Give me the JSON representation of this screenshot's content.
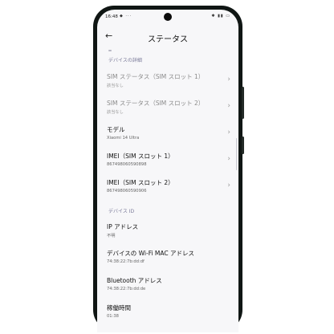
{
  "status_bar": {
    "time": "16:48",
    "left_icons": "◆ ···",
    "right_icons": "✱ ▮▮ ▭"
  },
  "header": {
    "back_icon": "←",
    "title": "ステータス"
  },
  "sections": {
    "device_details": "デバイスの詳細",
    "device_id": "デバイス ID"
  },
  "rows": [
    {
      "label": "SIM ステータス（SIM スロット 1）",
      "value": "該当なし",
      "chevron": "›"
    },
    {
      "label": "SIM ステータス（SIM スロット 2）",
      "value": "該当なし",
      "chevron": "›"
    },
    {
      "label": "モデル",
      "value": "Xiaomi 14 Ultra",
      "chevron": "›"
    },
    {
      "label": "IMEI（SIM スロット 1）",
      "value": "867498060590898",
      "chevron": "›"
    },
    {
      "label": "IMEI（SIM スロット 2）",
      "value": "867498060590906",
      "chevron": "›"
    },
    {
      "label": "IP アドレス",
      "value": "不明"
    },
    {
      "label": "デバイスの Wi-Fi MAC アドレス",
      "value": "74:38:22:7b:dd:df"
    },
    {
      "label": "Bluetooth アドレス",
      "value": "74:38:22:7b:dd:de"
    },
    {
      "label": "稼働時間",
      "value": "01:38"
    }
  ]
}
